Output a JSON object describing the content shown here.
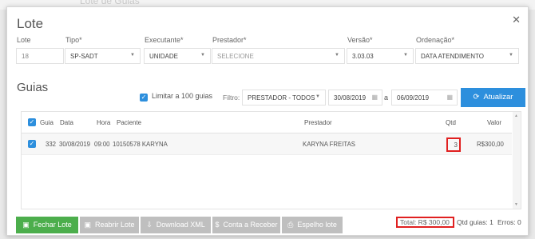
{
  "background": {
    "ghost_text": "Lote de Guias"
  },
  "modal": {
    "title": "Lote",
    "close_icon": "close-icon"
  },
  "fields": {
    "lote": {
      "label": "Lote",
      "value": "18"
    },
    "tipo": {
      "label": "Tipo*",
      "value": "SP-SADT"
    },
    "executante": {
      "label": "Executante*",
      "value": "UNIDADE"
    },
    "prestador": {
      "label": "Prestador*",
      "value": "SELECIONE"
    },
    "versao": {
      "label": "Versão*",
      "value": "3.03.03"
    },
    "ordenacao": {
      "label": "Ordenação*",
      "value": "DATA ATENDIMENTO"
    }
  },
  "guias": {
    "title": "Guias",
    "limit_label": "Limitar a 100 guias",
    "limit_checked": true,
    "filter_label": "Filtro:",
    "filter_value": "PRESTADOR - TODOS",
    "date_from": "30/08/2019",
    "date_sep": "a",
    "date_to": "06/09/2019",
    "refresh_label": "Atualizar",
    "refresh_icon": "refresh-icon",
    "accent": "#2d8fdd"
  },
  "table": {
    "columns": {
      "guia": "Guia",
      "data": "Data",
      "hora": "Hora",
      "paciente": "Paciente",
      "prestador": "Prestador",
      "qtd": "Qtd",
      "valor": "Valor"
    },
    "rows": [
      {
        "guia": "332",
        "data": "30/08/2019",
        "hora": "09:00",
        "paciente": "10150578 KARYNA",
        "prestador": "KARYNA FREITAS",
        "qtd": "3",
        "valor": "R$300,00",
        "checked": true
      }
    ]
  },
  "footer": {
    "buttons": {
      "fechar": "Fechar Lote",
      "reabrir": "Reabrir Lote",
      "download": "Download XML",
      "conta": "Conta a Receber",
      "espelho": "Espelho lote"
    },
    "total": "Total: R$ 300,00",
    "qtd_guias": "Qtd guias: 1",
    "erros": "Erros: 0"
  }
}
